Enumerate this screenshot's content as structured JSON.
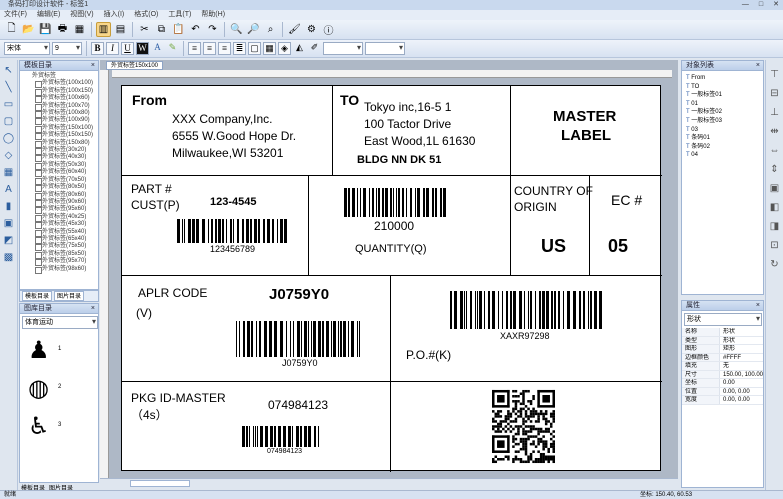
{
  "window": {
    "title": "条码打印设计软件 - 标签1",
    "min": "—",
    "max": "□",
    "close": "✕"
  },
  "menu": [
    "文件(F)",
    "编辑(E)",
    "视图(V)",
    "插入(I)",
    "格式(O)",
    "工具(T)",
    "帮助(H)"
  ],
  "toolbar2": {
    "font_name": "宋体",
    "font_size": "9",
    "bold": "B",
    "italic": "I",
    "underline": "U",
    "w_icon": "W",
    "zoom_select": "",
    "line_select": ""
  },
  "tree": {
    "root": "外贸标签",
    "items": [
      "外贸标签(100x100)",
      "外贸标签(100x150)",
      "外贸标签(100x60)",
      "外贸标签(100x70)",
      "外贸标签(100x80)",
      "外贸标签(100x90)",
      "外贸标签(150x100)",
      "外贸标签(150x150)",
      "外贸标签(150x80)",
      "外贸标签(30x20)",
      "外贸标签(40x30)",
      "外贸标签(50x30)",
      "外贸标签(60x40)",
      "外贸标签(70x50)",
      "外贸标签(80x50)",
      "外贸标签(80x60)",
      "外贸标签(90x60)",
      "外贸标签(95x60)",
      "外贸标签(40x25)",
      "外贸标签(45x30)",
      "外贸标签(55x40)",
      "外贸标签(65x40)",
      "外贸标签(75x50)",
      "外贸标签(85x50)",
      "外贸标签(95x70)",
      "外贸标签(98x60)"
    ]
  },
  "left_panel": {
    "title": "模板目录",
    "tabs": [
      "模板目录",
      "图片目录"
    ],
    "image_panel_title": "图库目录",
    "image_category": "体育运动"
  },
  "icons": [
    {
      "name": "bowling-icon",
      "glyph": "♟",
      "label": "1"
    },
    {
      "name": "basketball-icon",
      "glyph": "◍",
      "label": "2"
    },
    {
      "name": "fitness-icon",
      "glyph": "♿",
      "label": "3"
    }
  ],
  "bottom_tabs": [
    "模板目录",
    "图片目录"
  ],
  "doc_tab": "外贸标签150x100",
  "label": {
    "from_title": "From",
    "from_lines": [
      "XXX Company,Inc.",
      "6555 W.Good Hope Dr.",
      "Milwaukee,WI 53201"
    ],
    "to_title": "TO",
    "to_lines": [
      "Tokyo inc,16-5 1",
      "100 Tactor Drive",
      "East Wood,1L 61630"
    ],
    "to_bold": "BLDG NN DK 51",
    "master_label": [
      "MASTER",
      "LABEL"
    ],
    "part_label": "PART #",
    "cust_label": "CUST(P)",
    "part_value": "123-4545",
    "part_barcode_text": "123456789",
    "qty_barcode_text": "210000",
    "qty_label": "QUANTITY(Q)",
    "country_label": [
      "COUNTRY OF",
      "ORIGIN"
    ],
    "country_value": "US",
    "ec_label": "EC #",
    "ec_value": "05",
    "aplr_label": "APLR CODE",
    "aplr_sub": "(V)",
    "aplr_value": "J0759Y0",
    "aplr_barcode_text": "J0759Y0",
    "po_barcode_text": "XAXR97298",
    "po_label": "P.O.#(K)",
    "pkg_label": "PKG ID-MASTER",
    "pkg_sub": "（4s）",
    "pkg_value": "074984123",
    "pkg_barcode_text": "074984123"
  },
  "objects": {
    "title": "对象列表",
    "items": [
      "From",
      "TO",
      "一般标签01",
      "01",
      "一般标签02",
      "一般标签03",
      "03",
      "条码01",
      "条码02",
      "04"
    ]
  },
  "properties": {
    "title": "属性",
    "selector": "形状",
    "rows": [
      {
        "k": "名称",
        "v": "形状"
      },
      {
        "k": "类型",
        "v": "形状"
      },
      {
        "k": "图形",
        "v": "矩形"
      },
      {
        "k": "边框颜色",
        "v": "#FFFF"
      },
      {
        "k": "填充",
        "v": "无"
      },
      {
        "k": "尺寸",
        "v": "150.00, 100.00"
      },
      {
        "k": "坐标",
        "v": "0.00"
      },
      {
        "k": "位置",
        "v": "0.00, 0.00"
      },
      {
        "k": "宽度",
        "v": "0.00, 0.00"
      }
    ]
  },
  "status": {
    "left": "就绪",
    "right": "坐标: 150.40, 60.53"
  },
  "colors": {
    "panel": "#dfe6ef",
    "accent": "#3362a8",
    "label_bg": "#ffffff"
  }
}
